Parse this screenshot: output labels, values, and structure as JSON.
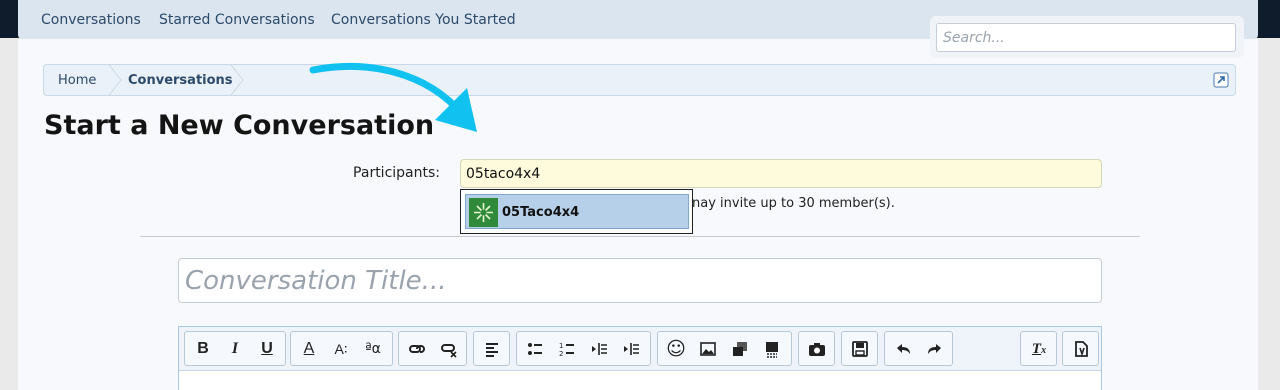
{
  "nav": {
    "tabs": [
      "Conversations",
      "Starred Conversations",
      "Conversations You Started"
    ]
  },
  "search": {
    "placeholder": "Search..."
  },
  "breadcrumb": {
    "items": [
      "Home",
      "Conversations"
    ]
  },
  "page": {
    "title": "Start a New Conversation"
  },
  "form": {
    "participants_label": "Participants:",
    "participants_value": "05taco4x4",
    "participants_explain": "You may invite up to 30 member(s).",
    "explain_visible": "nay invite up to 30 member(s).",
    "title_placeholder": "Conversation Title..."
  },
  "autocomplete": {
    "items": [
      {
        "label": "05Taco4x4",
        "avatar": "green-avatar"
      }
    ]
  },
  "toolbar": {
    "buttons": [
      {
        "name": "bold",
        "glyph": "B"
      },
      {
        "name": "italic",
        "glyph": "I"
      },
      {
        "name": "underline",
        "glyph": "U"
      },
      {
        "name": "text-color",
        "glyph": "A"
      },
      {
        "name": "font-size",
        "glyph": "A∶"
      },
      {
        "name": "font-family",
        "glyph": "ªα"
      },
      {
        "name": "link",
        "glyph": "link-icon"
      },
      {
        "name": "unlink",
        "glyph": "unlink-icon"
      },
      {
        "name": "align",
        "glyph": "align-icon"
      },
      {
        "name": "bullet-list",
        "glyph": "bullet-icon"
      },
      {
        "name": "numbered-list",
        "glyph": "number-icon"
      },
      {
        "name": "outdent",
        "glyph": "outdent-icon"
      },
      {
        "name": "indent",
        "glyph": "indent-icon"
      },
      {
        "name": "smilies",
        "glyph": "☺"
      },
      {
        "name": "image",
        "glyph": "image-icon"
      },
      {
        "name": "media",
        "glyph": "media-icon"
      },
      {
        "name": "insert",
        "glyph": "insert-icon"
      },
      {
        "name": "camera",
        "glyph": "camera-icon"
      },
      {
        "name": "save-draft",
        "glyph": "floppy-icon"
      },
      {
        "name": "undo",
        "glyph": "undo-icon"
      },
      {
        "name": "redo",
        "glyph": "redo-icon"
      },
      {
        "name": "remove-format",
        "glyph": "Tx"
      },
      {
        "name": "toggle-bbcode",
        "glyph": "bbcode-icon"
      }
    ]
  },
  "colors": {
    "topbar": "#0f1c2b",
    "nav_bg": "#dbe5ef",
    "link": "#2c4a6a",
    "arrow": "#11c2f0",
    "participants_bg": "#fdfbdc",
    "autocomplete_highlight": "#b5d0e8"
  }
}
